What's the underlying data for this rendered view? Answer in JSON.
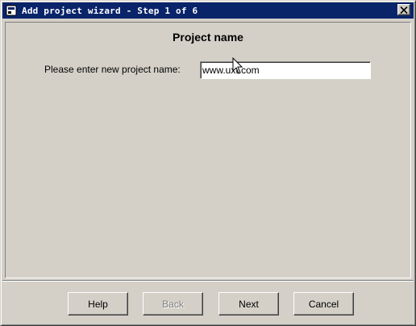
{
  "window": {
    "title": "Add project wizard - Step 1 of 6",
    "close_icon": "close-x-icon",
    "app_icon": "application-icon"
  },
  "page": {
    "heading": "Project name",
    "field_label": "Please enter new project name:",
    "project_name_value": "www.uxt.com"
  },
  "buttons": {
    "help": "Help",
    "back": "Back",
    "next": "Next",
    "cancel": "Cancel"
  },
  "colors": {
    "titlebar": "#0a246a",
    "face": "#d4d0c8"
  }
}
